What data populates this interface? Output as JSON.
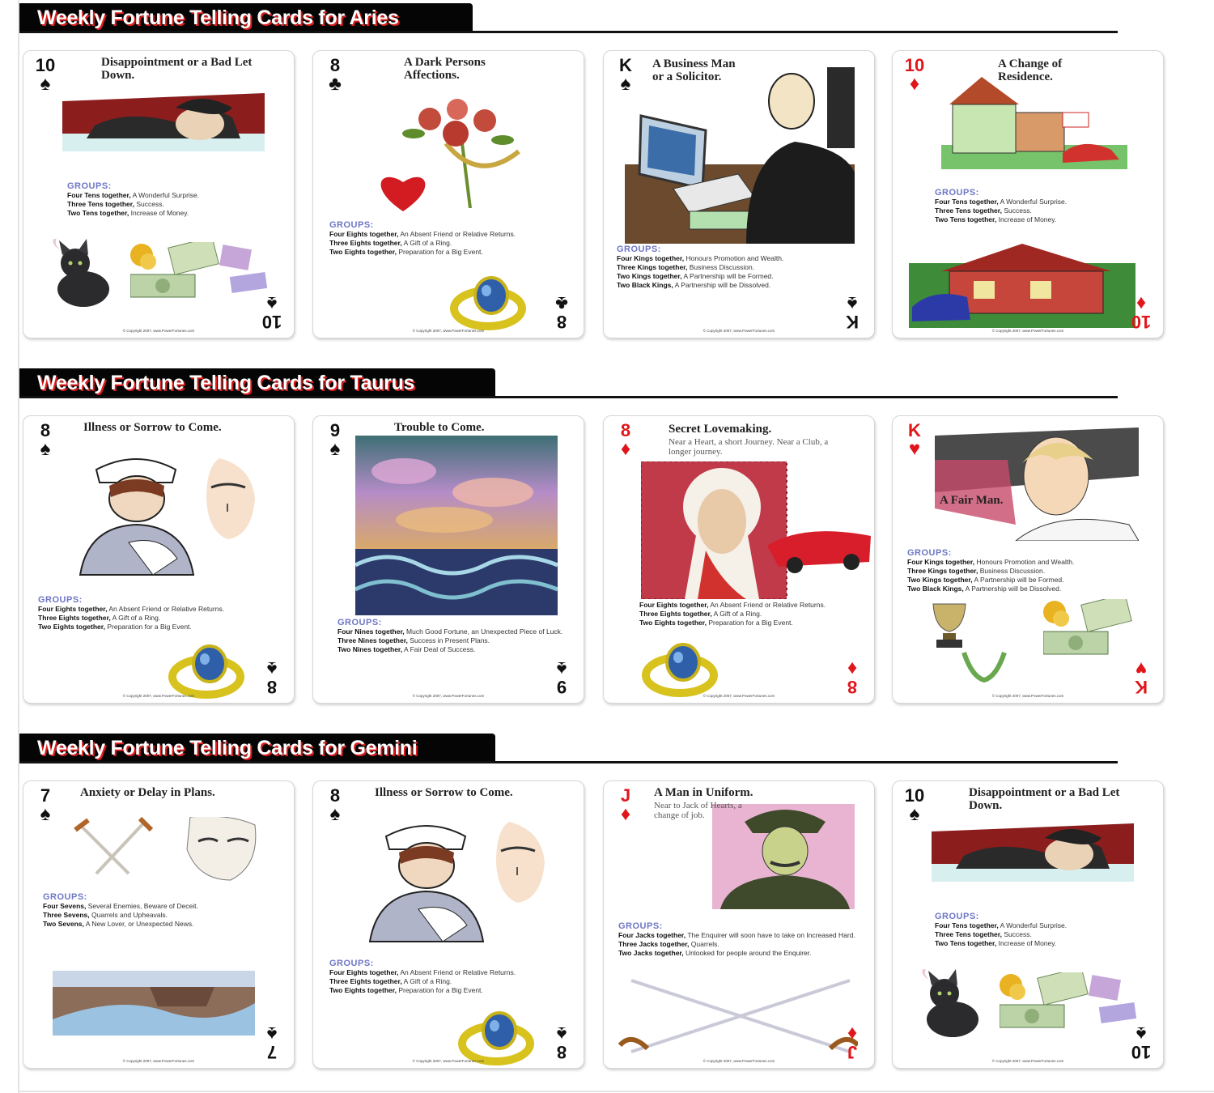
{
  "sections": [
    {
      "banner": "Weekly Fortune Telling Cards for Aries",
      "cards": [
        {
          "rank": "10",
          "suit": "♠",
          "color": "black",
          "title": "Disappointment or a Bad Let Down.",
          "subtitle": "",
          "groups_heading": "GROUPS:",
          "groups": [
            {
              "bold": "Four Tens together,",
              "text": "A Wonderful Surprise."
            },
            {
              "bold": "Three Tens together,",
              "text": "Success."
            },
            {
              "bold": "Two Tens together,",
              "text": "Increase of Money."
            }
          ],
          "copyright": "© Copyright 2007, www.PowerFortunes.com"
        },
        {
          "rank": "8",
          "suit": "♣",
          "color": "black",
          "title": "A Dark Persons Affections.",
          "subtitle": "",
          "groups_heading": "GROUPS:",
          "groups": [
            {
              "bold": "Four Eights together,",
              "text": "An Absent Friend or Relative Returns."
            },
            {
              "bold": "Three Eights together,",
              "text": "A Gift of a Ring."
            },
            {
              "bold": "Two Eights together,",
              "text": "Preparation for a Big Event."
            }
          ],
          "copyright": "© Copyright 2007, www.PowerFortunes.com"
        },
        {
          "rank": "K",
          "suit": "♠",
          "color": "black",
          "title": "A Business Man or a Solicitor.",
          "subtitle": "",
          "groups_heading": "GROUPS:",
          "groups": [
            {
              "bold": "Four Kings together,",
              "text": "Honours Promotion and Wealth."
            },
            {
              "bold": "Three Kings together,",
              "text": "Business Discussion."
            },
            {
              "bold": "Two Kings together,",
              "text": "A Partnership will be Formed."
            },
            {
              "bold": "Two Black Kings,",
              "text": "A Partnership will be Dissolved."
            }
          ],
          "copyright": "© Copyright 2007, www.PowerFortunes.com"
        },
        {
          "rank": "10",
          "suit": "♦",
          "color": "red",
          "title": "A Change of Residence.",
          "subtitle": "",
          "groups_heading": "GROUPS:",
          "groups": [
            {
              "bold": "Four Tens together,",
              "text": "A Wonderful Surprise."
            },
            {
              "bold": "Three Tens together,",
              "text": "Success."
            },
            {
              "bold": "Two Tens together,",
              "text": "Increase of Money."
            }
          ],
          "copyright": "© Copyright 2007, www.PowerFortunes.com"
        }
      ]
    },
    {
      "banner": "Weekly Fortune Telling Cards for Taurus",
      "cards": [
        {
          "rank": "8",
          "suit": "♠",
          "color": "black",
          "title": "Illness or Sorrow to Come.",
          "subtitle": "",
          "groups_heading": "GROUPS:",
          "groups": [
            {
              "bold": "Four Eights together,",
              "text": "An Absent Friend or Relative Returns."
            },
            {
              "bold": "Three Eights together,",
              "text": "A Gift of a Ring."
            },
            {
              "bold": "Two Eights together,",
              "text": "Preparation for a Big Event."
            }
          ],
          "copyright": "© Copyright 2007, www.PowerFortunes.com"
        },
        {
          "rank": "9",
          "suit": "♠",
          "color": "black",
          "title": "Trouble to Come.",
          "subtitle": "",
          "groups_heading": "GROUPS:",
          "groups": [
            {
              "bold": "Four Nines together,",
              "text": "Much Good Fortune, an Unexpected Piece of Luck."
            },
            {
              "bold": "Three Nines together,",
              "text": "Success in Present Plans."
            },
            {
              "bold": "Two Nines together,",
              "text": "A Fair Deal of Success."
            }
          ],
          "copyright": "© Copyright 2007, www.PowerFortunes.com"
        },
        {
          "rank": "8",
          "suit": "♦",
          "color": "red",
          "title": "Secret Lovemaking.",
          "subtitle": "Near a Heart, a short Journey. Near a Club, a longer journey.",
          "groups_heading": "",
          "groups": [
            {
              "bold": "Four Eights together,",
              "text": "An Absent Friend or Relative Returns."
            },
            {
              "bold": "Three Eights together,",
              "text": "A Gift of a Ring."
            },
            {
              "bold": "Two Eights together,",
              "text": "Preparation for a Big Event."
            }
          ],
          "copyright": "© Copyright 2007, www.PowerFortunes.com"
        },
        {
          "rank": "K",
          "suit": "♥",
          "color": "red",
          "title": "A Fair Man.",
          "subtitle": "",
          "groups_heading": "GROUPS:",
          "groups": [
            {
              "bold": "Four Kings together,",
              "text": "Honours Promotion and Wealth."
            },
            {
              "bold": "Three Kings together,",
              "text": "Business Discussion."
            },
            {
              "bold": "Two Kings together,",
              "text": "A Partnership will be Formed."
            },
            {
              "bold": "Two Black Kings,",
              "text": "A Partnership will be Dissolved."
            }
          ],
          "copyright": "© Copyright 2007, www.PowerFortunes.com"
        }
      ]
    },
    {
      "banner": "Weekly Fortune Telling Cards for Gemini",
      "cards": [
        {
          "rank": "7",
          "suit": "♠",
          "color": "black",
          "title": "Anxiety or Delay in Plans.",
          "subtitle": "",
          "groups_heading": "GROUPS:",
          "groups": [
            {
              "bold": "Four Sevens,",
              "text": "Several Enemies, Beware of Deceit."
            },
            {
              "bold": "Three Sevens,",
              "text": "Quarrels and Upheavals."
            },
            {
              "bold": "Two Sevens,",
              "text": "A New Lover, or Unexpected News."
            }
          ],
          "copyright": "© Copyright 2007, www.PowerFortunes.com"
        },
        {
          "rank": "8",
          "suit": "♠",
          "color": "black",
          "title": "Illness or Sorrow to Come.",
          "subtitle": "",
          "groups_heading": "GROUPS:",
          "groups": [
            {
              "bold": "Four Eights together,",
              "text": "An Absent Friend or Relative Returns."
            },
            {
              "bold": "Three Eights together,",
              "text": "A Gift of a Ring."
            },
            {
              "bold": "Two Eights together,",
              "text": "Preparation for a Big Event."
            }
          ],
          "copyright": "© Copyright 2007, www.PowerFortunes.com"
        },
        {
          "rank": "J",
          "suit": "♦",
          "color": "red",
          "title": "A Man in Uniform.",
          "subtitle": "Near to Jack of Hearts, a change of job.",
          "groups_heading": "GROUPS:",
          "groups": [
            {
              "bold": "Four Jacks together,",
              "text": "The Enquirer will soon have to take on Increased Hard."
            },
            {
              "bold": "Three Jacks together,",
              "text": "Quarrels."
            },
            {
              "bold": "Two Jacks together,",
              "text": "Unlooked for people around the Enquirer."
            }
          ],
          "copyright": "© Copyright 2007, www.PowerFortunes.com"
        },
        {
          "rank": "10",
          "suit": "♠",
          "color": "black",
          "title": "Disappointment or a Bad Let Down.",
          "subtitle": "",
          "groups_heading": "GROUPS:",
          "groups": [
            {
              "bold": "Four Tens together,",
              "text": "A Wonderful Surprise."
            },
            {
              "bold": "Three Tens together,",
              "text": "Success."
            },
            {
              "bold": "Two Tens together,",
              "text": "Increase of Money."
            }
          ],
          "copyright": "© Copyright 2007, www.PowerFortunes.com"
        }
      ]
    }
  ]
}
